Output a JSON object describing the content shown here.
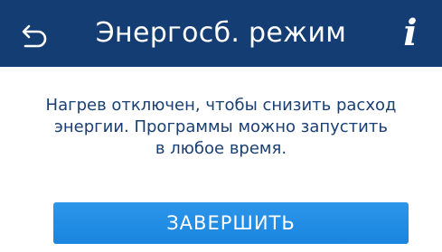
{
  "colors": {
    "header_bg": "#143d73",
    "header_fg": "#ffffff",
    "message_text": "#1a3f73",
    "button_bg": "#2189e3",
    "button_fg": "#ffffff"
  },
  "header": {
    "back_icon": "back-arrow-icon",
    "title": "Энергосб. режим",
    "info_label": "i",
    "info_icon": "info-icon"
  },
  "message": {
    "lines": [
      "Нагрев отключен, чтобы снизить расход",
      "энергии. Программы можно запустить",
      "в любое время."
    ]
  },
  "actions": {
    "finish_label": "ЗАВЕРШИТЬ"
  }
}
